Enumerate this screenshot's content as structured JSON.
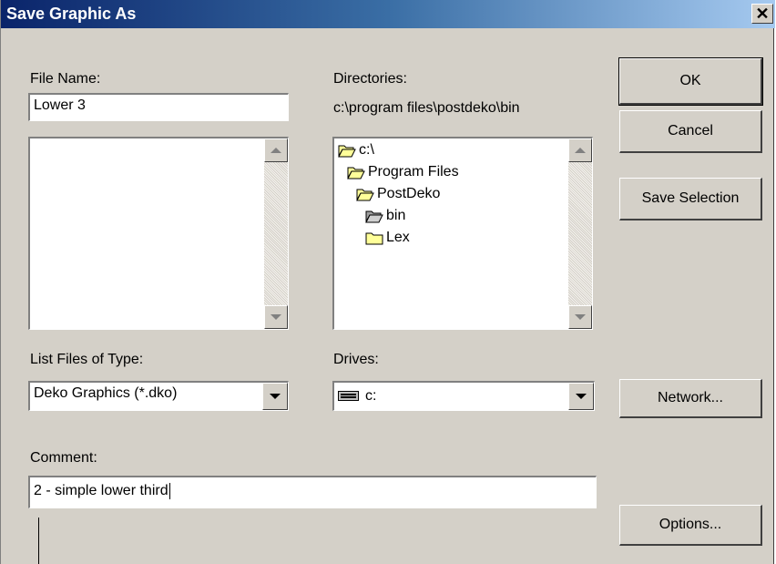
{
  "window": {
    "title": "Save Graphic As",
    "close_glyph": "✕"
  },
  "file_name": {
    "label": "File Name:",
    "value": "Lower 3"
  },
  "directories": {
    "label": "Directories:",
    "current_path": "c:\\program files\\postdeko\\bin",
    "items": [
      {
        "label": "c:\\",
        "icon": "open-folder-icon"
      },
      {
        "label": "Program Files",
        "icon": "open-folder-icon"
      },
      {
        "label": "PostDeko",
        "icon": "open-folder-icon"
      },
      {
        "label": "bin",
        "icon": "open-folder-icon"
      },
      {
        "label": "Lex",
        "icon": "closed-folder-icon"
      }
    ]
  },
  "list_files_of_type": {
    "label": "List Files of Type:",
    "value": "Deko Graphics (*.dko)"
  },
  "drives": {
    "label": "Drives:",
    "value": "c:",
    "icon": "drive-icon"
  },
  "comment": {
    "label": "Comment:",
    "value": "2 - simple lower third"
  },
  "buttons": {
    "ok": "OK",
    "cancel": "Cancel",
    "save_selection": "Save Selection",
    "network": "Network...",
    "options": "Options..."
  },
  "colors": {
    "title_gradient_start": "#0a246a",
    "title_gradient_end": "#a6caf0",
    "dialog_face": "#d4d0c8",
    "folder_yellow": "#ffff99"
  }
}
